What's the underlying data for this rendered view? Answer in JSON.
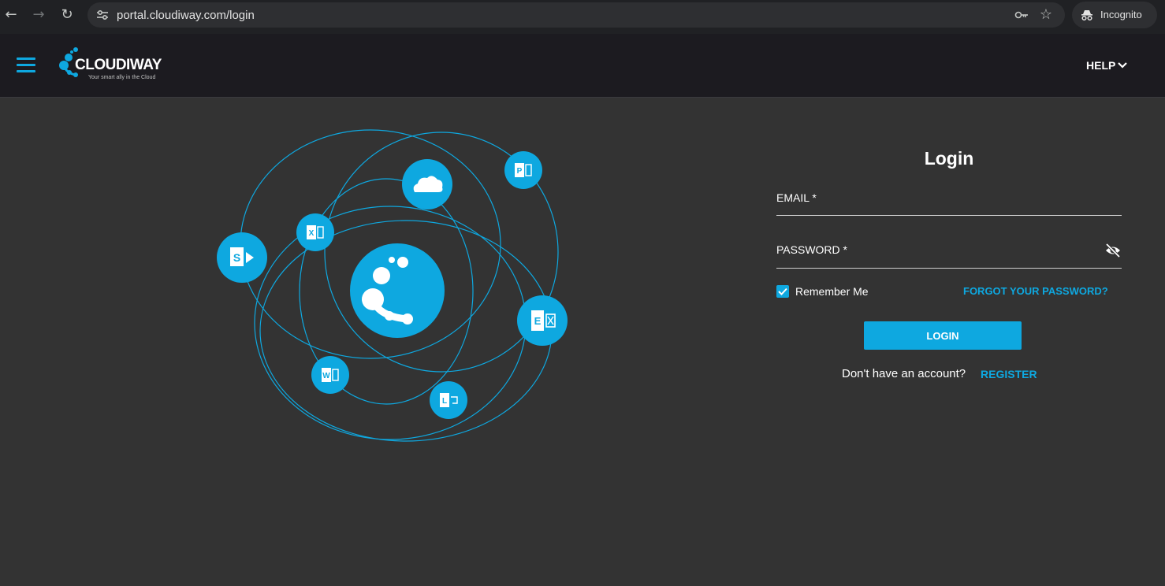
{
  "browser": {
    "url": "portal.cloudiway.com/login",
    "incognito_label": "Incognito"
  },
  "header": {
    "logo_text": "CLOUDIWAY",
    "logo_tagline": "Your smart ally in the Cloud",
    "help_label": "HELP"
  },
  "login": {
    "title": "Login",
    "email_label": "EMAIL *",
    "password_label": "PASSWORD *",
    "remember_label": "Remember Me",
    "remember_checked": true,
    "forgot_label": "FORGOT YOUR PASSWORD?",
    "login_button": "LOGIN",
    "no_account_text": "Don't have an account?",
    "register_label": "REGISTER"
  },
  "illustration": {
    "icons": [
      "sharepoint-icon",
      "excel-icon",
      "onedrive-icon",
      "publisher-icon",
      "cloudiway-core-icon",
      "exchange-icon",
      "word-icon",
      "lync-icon"
    ],
    "icon_letters": {
      "sharepoint": "S",
      "excel": "X",
      "publisher": "P",
      "exchange": "E",
      "word": "W",
      "lync": "L"
    }
  },
  "colors": {
    "accent": "#0ea8e0",
    "page_bg": "#333333",
    "header_bg": "#1c1b20"
  }
}
